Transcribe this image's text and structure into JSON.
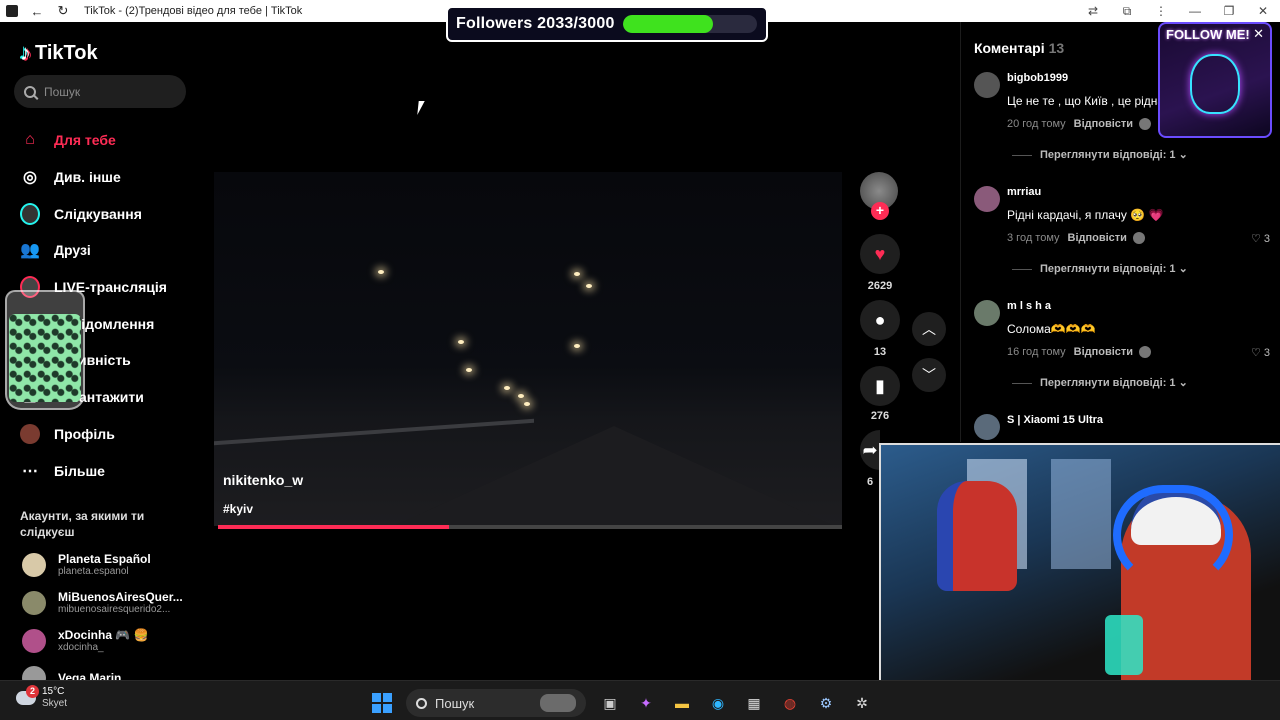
{
  "browser": {
    "tab_title": "TikTok - (2)Трендові відео для тебе | TikTok",
    "nav_icons": [
      "back-icon",
      "reload-icon"
    ],
    "right_icons": [
      "translate-icon",
      "extensions-icon",
      "menu-dots-icon",
      "minimize-icon",
      "restore-icon",
      "close-icon"
    ]
  },
  "followers_overlay": {
    "text": "Followers 2033/3000",
    "current": 2033,
    "goal": 3000,
    "bar_color": "#3fe21e"
  },
  "sidebar": {
    "logo": "TikTok",
    "search_placeholder": "Пошук",
    "menu": [
      {
        "label": "Для тебе",
        "icon": "home-icon",
        "active": true
      },
      {
        "label": "Див. інше",
        "icon": "compass-icon",
        "active": false
      },
      {
        "label": "Слідкування",
        "icon": "following-avatar-icon",
        "active": false
      },
      {
        "label": "Друзі",
        "icon": "friends-icon",
        "active": false
      },
      {
        "label": "LIVE-трансляція",
        "icon": "live-icon",
        "active": false
      },
      {
        "label": "Повідомлення",
        "icon": "message-icon",
        "active": false
      },
      {
        "label": "Активність",
        "icon": "activity-icon",
        "active": false
      },
      {
        "label": "Завантажити",
        "icon": "upload-icon",
        "active": false
      },
      {
        "label": "Профіль",
        "icon": "profile-avatar-icon",
        "active": false
      },
      {
        "label": "Більше",
        "icon": "more-dots-icon",
        "active": false
      }
    ],
    "following_title": "Акаунти, за якими ти слідкуєш",
    "accounts": [
      {
        "name": "Planeta Español",
        "handle": "planeta.espanol",
        "color": "#d8c9a8"
      },
      {
        "name": "MiBuenosAiresQuer...",
        "handle": "mibuenosairesquerido2...",
        "color": "#8a8a6a"
      },
      {
        "name": "xDocinha 🎮 🍔",
        "handle": "xdocinha_",
        "color": "#b0508a"
      },
      {
        "name": "Vega Marin",
        "handle": "",
        "color": "#999999"
      }
    ]
  },
  "video": {
    "author": "nikitenko_w",
    "hashtag": "#kyiv",
    "progress": 0.37
  },
  "actions": {
    "likes": "2629",
    "comments": "13",
    "saves": "276",
    "shares": "6"
  },
  "comments_panel": {
    "title": "Коментарі",
    "count": "13",
    "items": [
      {
        "user": "bigbob1999",
        "text": "Це не те , що Київ , це рідна Солома ❤",
        "time": "20 год тому",
        "reply": "Відповісти",
        "likes": "",
        "view_replies": "Переглянути відповіді: 1 ⌄",
        "avatar_color": "#555555"
      },
      {
        "user": "mrriau",
        "text": "Рідні кардачі, я плачу 🥺 💗",
        "time": "3 год тому",
        "reply": "Відповісти",
        "likes": "♡ 3",
        "view_replies": "Переглянути відповіді: 1 ⌄",
        "avatar_color": "#8a5a7a"
      },
      {
        "user": "m l s h a",
        "text": "Солома🫶🫶🫶",
        "time": "16 год тому",
        "reply": "Відповісти",
        "likes": "♡ 3",
        "view_replies": "Переглянути відповіді: 1 ⌄",
        "avatar_color": "#6a7a6a"
      },
      {
        "user": "S | Xiaomi 15 Ultra",
        "text": "",
        "time": "",
        "reply": "",
        "likes": "",
        "view_replies": "",
        "avatar_color": "#5a6a7a"
      }
    ]
  },
  "follow_me_overlay": {
    "text": "FOLLOW ME!"
  },
  "taskbar": {
    "weather_temp": "15°C",
    "weather_place": "Skyet",
    "weather_badge": "2",
    "search_label": "Пошук",
    "icons": [
      "windows-start-icon",
      "task-view-icon",
      "copilot-icon",
      "file-explorer-icon",
      "edge-icon",
      "store-icon",
      "chrome-icon",
      "steam-icon",
      "settings-icon"
    ]
  }
}
